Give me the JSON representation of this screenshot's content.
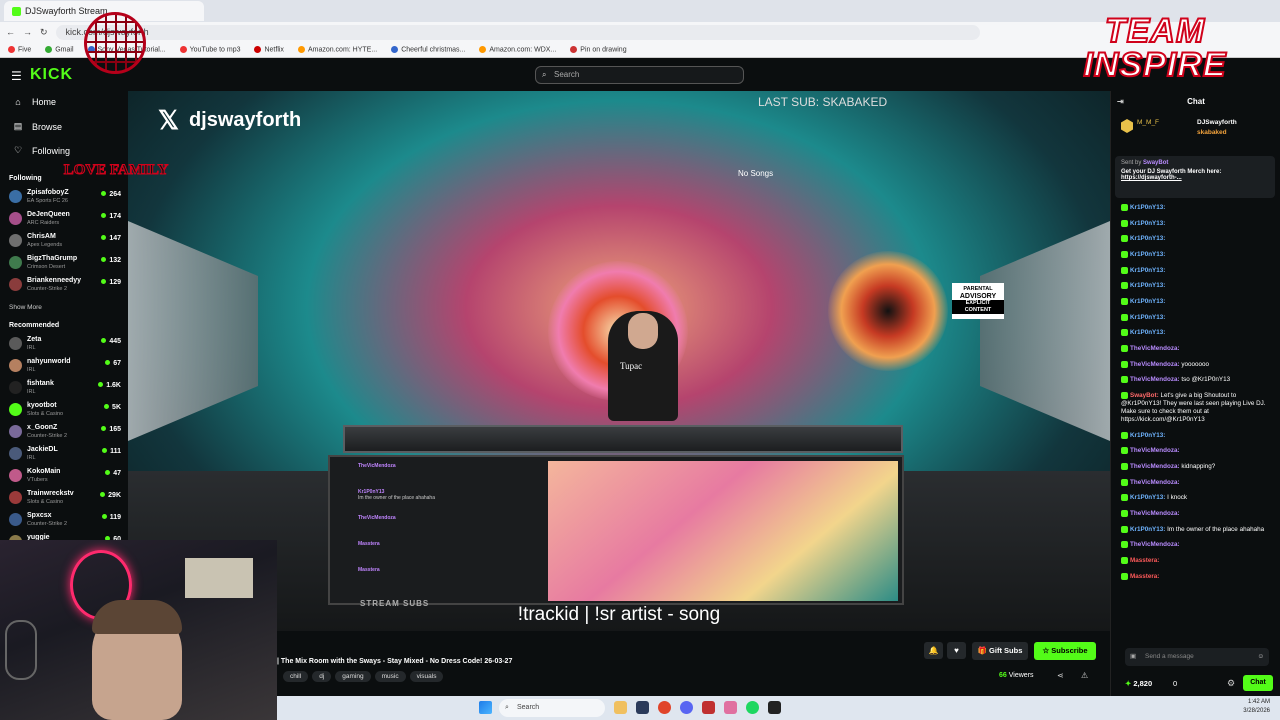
{
  "browser": {
    "tab_title": "DJSwayforth Stream",
    "url": "kick.com/djswayforth",
    "bookmarks": [
      "Five",
      "Gmail",
      "Sony Vegas Tutorial...",
      "YouTube to mp3",
      "Netflix",
      "Amazon.com: HYTE...",
      "Cheerful christmas...",
      "Amazon.com: WDX...",
      "Pin on drawing"
    ]
  },
  "header": {
    "logo": "KICK",
    "search_placeholder": "Search"
  },
  "sidebar": {
    "nav": [
      {
        "label": "Home",
        "icon": "home-icon"
      },
      {
        "label": "Browse",
        "icon": "browse-icon"
      },
      {
        "label": "Following",
        "icon": "heart-icon"
      }
    ],
    "following_heading": "Following",
    "following": [
      {
        "name": "ZpisafoboyZ",
        "game": "EA Sports FC 26",
        "viewers": "264",
        "color": "#3a6ea5"
      },
      {
        "name": "DeJenQueen",
        "game": "ARC Raiders",
        "viewers": "174",
        "color": "#a54f8a"
      },
      {
        "name": "ChrisAM",
        "game": "Apex Legends",
        "viewers": "147",
        "color": "#6f6f6f"
      },
      {
        "name": "BigzThaGrump",
        "game": "Crimson Desert",
        "viewers": "132",
        "color": "#3f7a4d"
      },
      {
        "name": "Briankenneedyy",
        "game": "Counter-Strike 2",
        "viewers": "129",
        "color": "#8a3c3c"
      }
    ],
    "show_more": "Show More",
    "recommended_heading": "Recommended",
    "recommended": [
      {
        "name": "Zeta",
        "game": "IRL",
        "viewers": "445",
        "color": "#5a5a5a"
      },
      {
        "name": "nahyunworld",
        "game": "IRL",
        "viewers": "67",
        "color": "#b58060"
      },
      {
        "name": "fishtank",
        "game": "IRL",
        "viewers": "1.6K",
        "color": "#222222"
      },
      {
        "name": "kyootbot",
        "game": "Slots & Casino",
        "viewers": "5K",
        "color": "#53fc18"
      },
      {
        "name": "x_GoonZ",
        "game": "Counter-Strike 2",
        "viewers": "165",
        "color": "#7a6a9a"
      },
      {
        "name": "JackieDL",
        "game": "IRL",
        "viewers": "111",
        "color": "#4a5a7a"
      },
      {
        "name": "KokoMain",
        "game": "VTubers",
        "viewers": "47",
        "color": "#c05a8a"
      },
      {
        "name": "Trainwreckstv",
        "game": "Slots & Casino",
        "viewers": "29K",
        "color": "#9a3a3a"
      },
      {
        "name": "Spxcsx",
        "game": "Counter-Strike 2",
        "viewers": "119",
        "color": "#3a5a8a"
      },
      {
        "name": "yuggie",
        "game": "",
        "viewers": "60",
        "color": "#8a7a4a"
      }
    ]
  },
  "player": {
    "x_handle": "djswayforth",
    "last_sub": "LAST SUB: SKABAKED",
    "no_songs": "No Songs",
    "advisory": [
      "PARENTAL",
      "ADVISORY",
      "EXPLICIT CONTENT"
    ],
    "dj_shirt": "Tupac",
    "trackid": "!trackid | !sr artist - song",
    "stream_subs": "STREAM SUBS",
    "mini_chat": [
      {
        "user": "TheVicMendoza",
        "text": ""
      },
      {
        "user": "Kr1P0nY13",
        "text": "Im the owner of the place ahahaha"
      },
      {
        "user": "TheVicMendoza",
        "text": ""
      },
      {
        "user": "Masstera",
        "text": ""
      },
      {
        "user": "Masstera",
        "text": ""
      }
    ]
  },
  "overlay_logos": {
    "team_line1": "TEAM",
    "team_line2": "INSPIRE",
    "badge_text": "LOVE FAMILY"
  },
  "stream_info": {
    "title": "| The Mix Room with the Sways - Stay Mixed - No Dress Code! 26-03-27",
    "tags": [
      "chill",
      "dj",
      "gaming",
      "music",
      "visuals"
    ],
    "gift_label": "Gift Subs",
    "subscribe_label": "Subscribe",
    "viewers": "66",
    "viewers_label": "Viewers"
  },
  "chat": {
    "title": "Chat",
    "leaders": {
      "first": "M_M_F",
      "second": "DJSwayforth",
      "third": "skabaked"
    },
    "pinned_from_label": "Sent by",
    "pinned_from": "SwayBot",
    "pinned_text": "Get your DJ Swayforth Merch here:",
    "pinned_link": "https://djswayforth-...",
    "messages": [
      {
        "user": "Kr1P0nY13:",
        "color": "#6fb4ff",
        "text": ""
      },
      {
        "user": "Kr1P0nY13:",
        "color": "#6fb4ff",
        "text": ""
      },
      {
        "user": "Kr1P0nY13:",
        "color": "#6fb4ff",
        "text": ""
      },
      {
        "user": "Kr1P0nY13:",
        "color": "#6fb4ff",
        "text": ""
      },
      {
        "user": "Kr1P0nY13:",
        "color": "#6fb4ff",
        "text": ""
      },
      {
        "user": "Kr1P0nY13:",
        "color": "#6fb4ff",
        "text": ""
      },
      {
        "user": "Kr1P0nY13:",
        "color": "#6fb4ff",
        "text": ""
      },
      {
        "user": "Kr1P0nY13:",
        "color": "#6fb4ff",
        "text": ""
      },
      {
        "user": "Kr1P0nY13:",
        "color": "#6fb4ff",
        "text": ""
      },
      {
        "user": "TheVicMendoza:",
        "color": "#b98cff",
        "text": ""
      },
      {
        "user": "TheVicMendoza:",
        "color": "#b98cff",
        "text": "yooooooo"
      },
      {
        "user": "TheVicMendoza:",
        "color": "#b98cff",
        "text": "tso @Kr1P0nY13"
      },
      {
        "user": "SwayBot:",
        "color": "#ff6a6a",
        "text": "Let's give a big Shoutout to @Kr1P0nY13! They were last seen playing Live DJ. Make sure to check them out at https://kick.com/@Kr1P0nY13"
      },
      {
        "user": "Kr1P0nY13:",
        "color": "#6fb4ff",
        "text": ""
      },
      {
        "user": "TheVicMendoza:",
        "color": "#b98cff",
        "text": ""
      },
      {
        "user": "TheVicMendoza:",
        "color": "#b98cff",
        "text": "kidnapping?"
      },
      {
        "user": "TheVicMendoza:",
        "color": "#b98cff",
        "text": ""
      },
      {
        "user": "Kr1P0nY13:",
        "color": "#6fb4ff",
        "text": "I knock"
      },
      {
        "user": "TheVicMendoza:",
        "color": "#b98cff",
        "text": ""
      },
      {
        "user": "Kr1P0nY13:",
        "color": "#6fb4ff",
        "text": "Im the owner of the place ahahaha"
      },
      {
        "user": "TheVicMendoza:",
        "color": "#b98cff",
        "text": ""
      },
      {
        "user": "Masstera:",
        "color": "#ff5a5a",
        "text": ""
      },
      {
        "user": "Masstera:",
        "color": "#ff5a5a",
        "text": ""
      }
    ],
    "input_placeholder": "Send a message",
    "points": "2,820",
    "count": "0",
    "send_label": "Chat"
  },
  "taskbar": {
    "search_placeholder": "Search",
    "time": "1:42 AM",
    "date": "3/28/2026"
  }
}
